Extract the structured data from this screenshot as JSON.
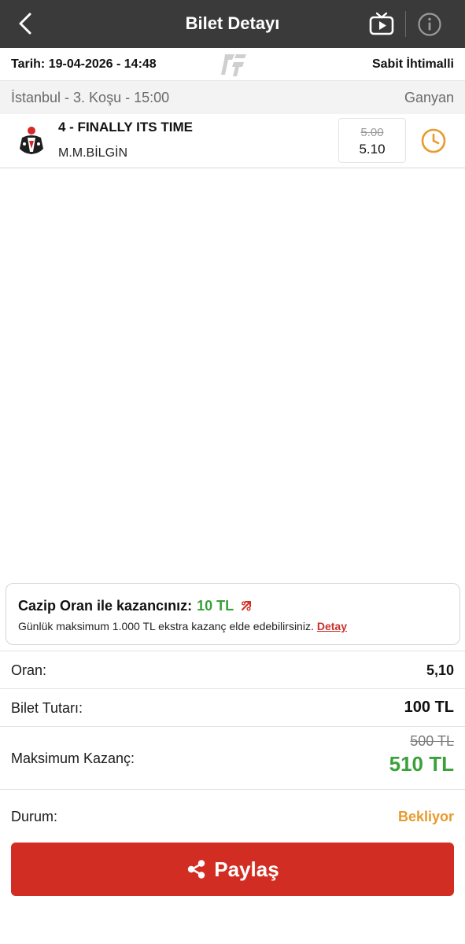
{
  "header": {
    "title": "Bilet Detayı",
    "back_icon": "back-chevron-icon",
    "tv_icon": "tv-play-icon",
    "info_icon": "info-icon"
  },
  "ticket": {
    "date": "Tarih: 19-04-2026 - 14:48",
    "type": "Sabit İhtimalli",
    "logo_icon": "tjk-logo-icon"
  },
  "race": {
    "info": "İstanbul - 3. Koşu - 15:00",
    "bet_type": "Ganyan"
  },
  "horse": {
    "name": "4 - FINALLY ITS TIME",
    "jockey": "M.M.BİLGİN",
    "odd_old": "5.00",
    "odd_new": "5.10",
    "status_icon": "clock-icon"
  },
  "promo": {
    "title": "Cazip Oran ile kazancınız:",
    "amount": "10 TL",
    "desc": "Günlük maksimum 1.000 TL ekstra kazanç elde edebilirsiniz.",
    "link": "Detay"
  },
  "summary": {
    "odds_label": "Oran:",
    "odds_value": "5,10",
    "amount_label": "Bilet Tutarı:",
    "amount_value": "100 TL",
    "max_label": "Maksimum Kazanç:",
    "max_old": "500 TL",
    "max_new": "510 TL",
    "status_label": "Durum:",
    "status_value": "Bekliyor"
  },
  "share": {
    "label": "Paylaş",
    "icon": "share-icon"
  },
  "colors": {
    "header_bg": "#3a3a3a",
    "accent_red": "#d22d22",
    "green": "#3aa13a",
    "orange": "#e89a2c"
  }
}
